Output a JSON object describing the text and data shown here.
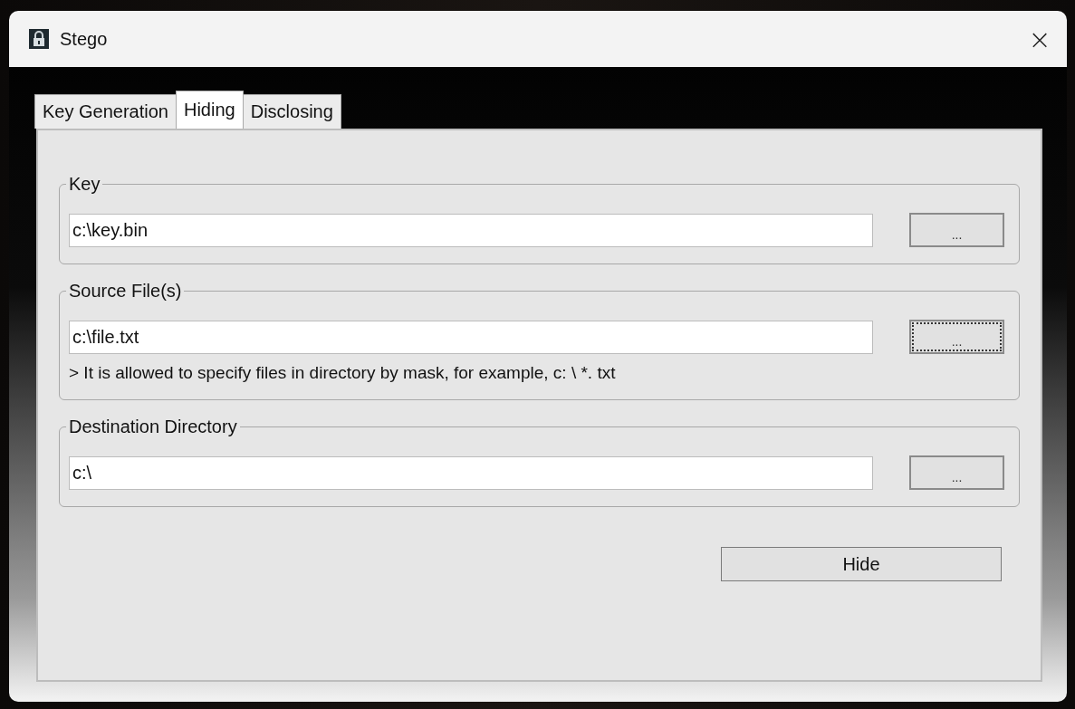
{
  "window": {
    "title": "Stego",
    "close": "×"
  },
  "tabs": [
    {
      "label": "Key Generation",
      "selected": false
    },
    {
      "label": "Hiding",
      "selected": true
    },
    {
      "label": "Disclosing",
      "selected": false
    }
  ],
  "groups": [
    {
      "legend": "Key",
      "value": "c:\\key.bin",
      "browse": {
        "label": "...",
        "focused": false
      }
    },
    {
      "legend": "Source File(s)",
      "value": "c:\\file.txt",
      "browse": {
        "label": "...",
        "focused": true
      },
      "hint": "> It is allowed to specify files in directory by mask, for example, c: \\ *. txt"
    },
    {
      "legend": "Destination Directory",
      "value": "c:\\",
      "browse": {
        "label": "...",
        "focused": false
      }
    }
  ],
  "action_button": "Hide"
}
